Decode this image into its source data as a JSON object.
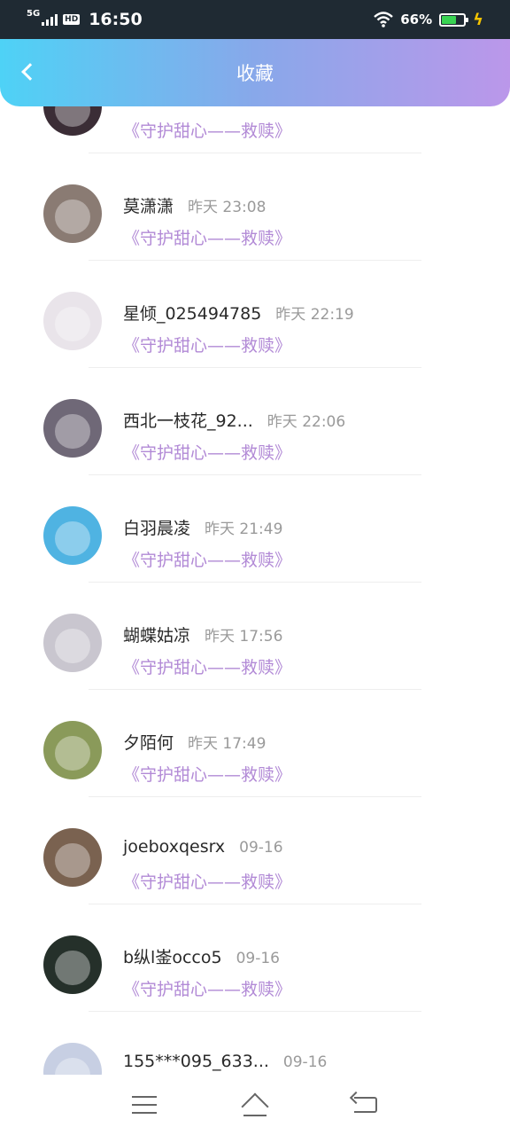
{
  "status_bar": {
    "network": "5G",
    "hd": "HD",
    "time": "16:50",
    "battery_pct": "66%",
    "battery_level": 0.66,
    "icons": [
      "signal-icon",
      "wifi-icon",
      "battery-icon",
      "charging-icon"
    ]
  },
  "header": {
    "title": "收藏",
    "back_icon": "back-chevron-icon"
  },
  "list": {
    "items": [
      {
        "name": "",
        "time": "",
        "title": "《守护甜心——救赎》",
        "avatar_color": "#3b2d36"
      },
      {
        "name": "莫潇潇",
        "time": "昨天 23:08",
        "title": "《守护甜心——救赎》",
        "avatar_color": "#8a7b73"
      },
      {
        "name": "星倾_025494785",
        "time": "昨天 22:19",
        "title": "《守护甜心——救赎》",
        "avatar_color": "#e9e4ea"
      },
      {
        "name": "西北一枝花_92...",
        "time": "昨天 22:06",
        "title": "《守护甜心——救赎》",
        "avatar_color": "#6f6877"
      },
      {
        "name": "白羽晨凌",
        "time": "昨天 21:49",
        "title": "《守护甜心——救赎》",
        "avatar_color": "#4fb3e2"
      },
      {
        "name": "蝴蝶姑凉",
        "time": "昨天 17:56",
        "title": "《守护甜心——救赎》",
        "avatar_color": "#c9c6cf"
      },
      {
        "name": "夕陌何",
        "time": "昨天 17:49",
        "title": "《守护甜心——救赎》",
        "avatar_color": "#8a9a5a"
      },
      {
        "name": "joeboxqesrx",
        "time": "09-16",
        "title": "《守护甜心——救赎》",
        "avatar_color": "#7a6250"
      },
      {
        "name": "b纵l崟occo5",
        "time": "09-16",
        "title": "《守护甜心——救赎》",
        "avatar_color": "#25302a"
      },
      {
        "name": "155***095_633...",
        "time": "09-16",
        "title": "",
        "avatar_color": "#c7cfe3"
      }
    ]
  },
  "bottom_nav": {
    "icons": [
      "menu-icon",
      "home-icon",
      "back-icon"
    ]
  },
  "colors": {
    "header_gradient_start": "#4ed2f6",
    "header_gradient_end": "#bb97ea",
    "accent_title": "#b28ad6"
  }
}
